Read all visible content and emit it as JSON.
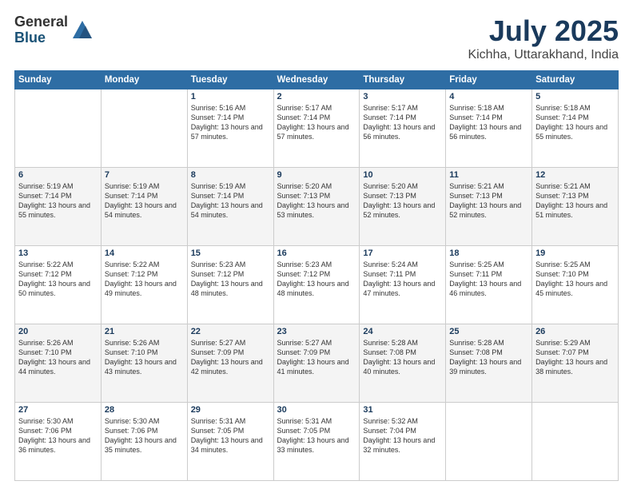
{
  "logo": {
    "general": "General",
    "blue": "Blue"
  },
  "title": "July 2025",
  "location": "Kichha, Uttarakhand, India",
  "days_header": [
    "Sunday",
    "Monday",
    "Tuesday",
    "Wednesday",
    "Thursday",
    "Friday",
    "Saturday"
  ],
  "weeks": [
    [
      {
        "day": "",
        "info": ""
      },
      {
        "day": "",
        "info": ""
      },
      {
        "day": "1",
        "info": "Sunrise: 5:16 AM\nSunset: 7:14 PM\nDaylight: 13 hours and 57 minutes."
      },
      {
        "day": "2",
        "info": "Sunrise: 5:17 AM\nSunset: 7:14 PM\nDaylight: 13 hours and 57 minutes."
      },
      {
        "day": "3",
        "info": "Sunrise: 5:17 AM\nSunset: 7:14 PM\nDaylight: 13 hours and 56 minutes."
      },
      {
        "day": "4",
        "info": "Sunrise: 5:18 AM\nSunset: 7:14 PM\nDaylight: 13 hours and 56 minutes."
      },
      {
        "day": "5",
        "info": "Sunrise: 5:18 AM\nSunset: 7:14 PM\nDaylight: 13 hours and 55 minutes."
      }
    ],
    [
      {
        "day": "6",
        "info": "Sunrise: 5:19 AM\nSunset: 7:14 PM\nDaylight: 13 hours and 55 minutes."
      },
      {
        "day": "7",
        "info": "Sunrise: 5:19 AM\nSunset: 7:14 PM\nDaylight: 13 hours and 54 minutes."
      },
      {
        "day": "8",
        "info": "Sunrise: 5:19 AM\nSunset: 7:14 PM\nDaylight: 13 hours and 54 minutes."
      },
      {
        "day": "9",
        "info": "Sunrise: 5:20 AM\nSunset: 7:13 PM\nDaylight: 13 hours and 53 minutes."
      },
      {
        "day": "10",
        "info": "Sunrise: 5:20 AM\nSunset: 7:13 PM\nDaylight: 13 hours and 52 minutes."
      },
      {
        "day": "11",
        "info": "Sunrise: 5:21 AM\nSunset: 7:13 PM\nDaylight: 13 hours and 52 minutes."
      },
      {
        "day": "12",
        "info": "Sunrise: 5:21 AM\nSunset: 7:13 PM\nDaylight: 13 hours and 51 minutes."
      }
    ],
    [
      {
        "day": "13",
        "info": "Sunrise: 5:22 AM\nSunset: 7:12 PM\nDaylight: 13 hours and 50 minutes."
      },
      {
        "day": "14",
        "info": "Sunrise: 5:22 AM\nSunset: 7:12 PM\nDaylight: 13 hours and 49 minutes."
      },
      {
        "day": "15",
        "info": "Sunrise: 5:23 AM\nSunset: 7:12 PM\nDaylight: 13 hours and 48 minutes."
      },
      {
        "day": "16",
        "info": "Sunrise: 5:23 AM\nSunset: 7:12 PM\nDaylight: 13 hours and 48 minutes."
      },
      {
        "day": "17",
        "info": "Sunrise: 5:24 AM\nSunset: 7:11 PM\nDaylight: 13 hours and 47 minutes."
      },
      {
        "day": "18",
        "info": "Sunrise: 5:25 AM\nSunset: 7:11 PM\nDaylight: 13 hours and 46 minutes."
      },
      {
        "day": "19",
        "info": "Sunrise: 5:25 AM\nSunset: 7:10 PM\nDaylight: 13 hours and 45 minutes."
      }
    ],
    [
      {
        "day": "20",
        "info": "Sunrise: 5:26 AM\nSunset: 7:10 PM\nDaylight: 13 hours and 44 minutes."
      },
      {
        "day": "21",
        "info": "Sunrise: 5:26 AM\nSunset: 7:10 PM\nDaylight: 13 hours and 43 minutes."
      },
      {
        "day": "22",
        "info": "Sunrise: 5:27 AM\nSunset: 7:09 PM\nDaylight: 13 hours and 42 minutes."
      },
      {
        "day": "23",
        "info": "Sunrise: 5:27 AM\nSunset: 7:09 PM\nDaylight: 13 hours and 41 minutes."
      },
      {
        "day": "24",
        "info": "Sunrise: 5:28 AM\nSunset: 7:08 PM\nDaylight: 13 hours and 40 minutes."
      },
      {
        "day": "25",
        "info": "Sunrise: 5:28 AM\nSunset: 7:08 PM\nDaylight: 13 hours and 39 minutes."
      },
      {
        "day": "26",
        "info": "Sunrise: 5:29 AM\nSunset: 7:07 PM\nDaylight: 13 hours and 38 minutes."
      }
    ],
    [
      {
        "day": "27",
        "info": "Sunrise: 5:30 AM\nSunset: 7:06 PM\nDaylight: 13 hours and 36 minutes."
      },
      {
        "day": "28",
        "info": "Sunrise: 5:30 AM\nSunset: 7:06 PM\nDaylight: 13 hours and 35 minutes."
      },
      {
        "day": "29",
        "info": "Sunrise: 5:31 AM\nSunset: 7:05 PM\nDaylight: 13 hours and 34 minutes."
      },
      {
        "day": "30",
        "info": "Sunrise: 5:31 AM\nSunset: 7:05 PM\nDaylight: 13 hours and 33 minutes."
      },
      {
        "day": "31",
        "info": "Sunrise: 5:32 AM\nSunset: 7:04 PM\nDaylight: 13 hours and 32 minutes."
      },
      {
        "day": "",
        "info": ""
      },
      {
        "day": "",
        "info": ""
      }
    ]
  ]
}
